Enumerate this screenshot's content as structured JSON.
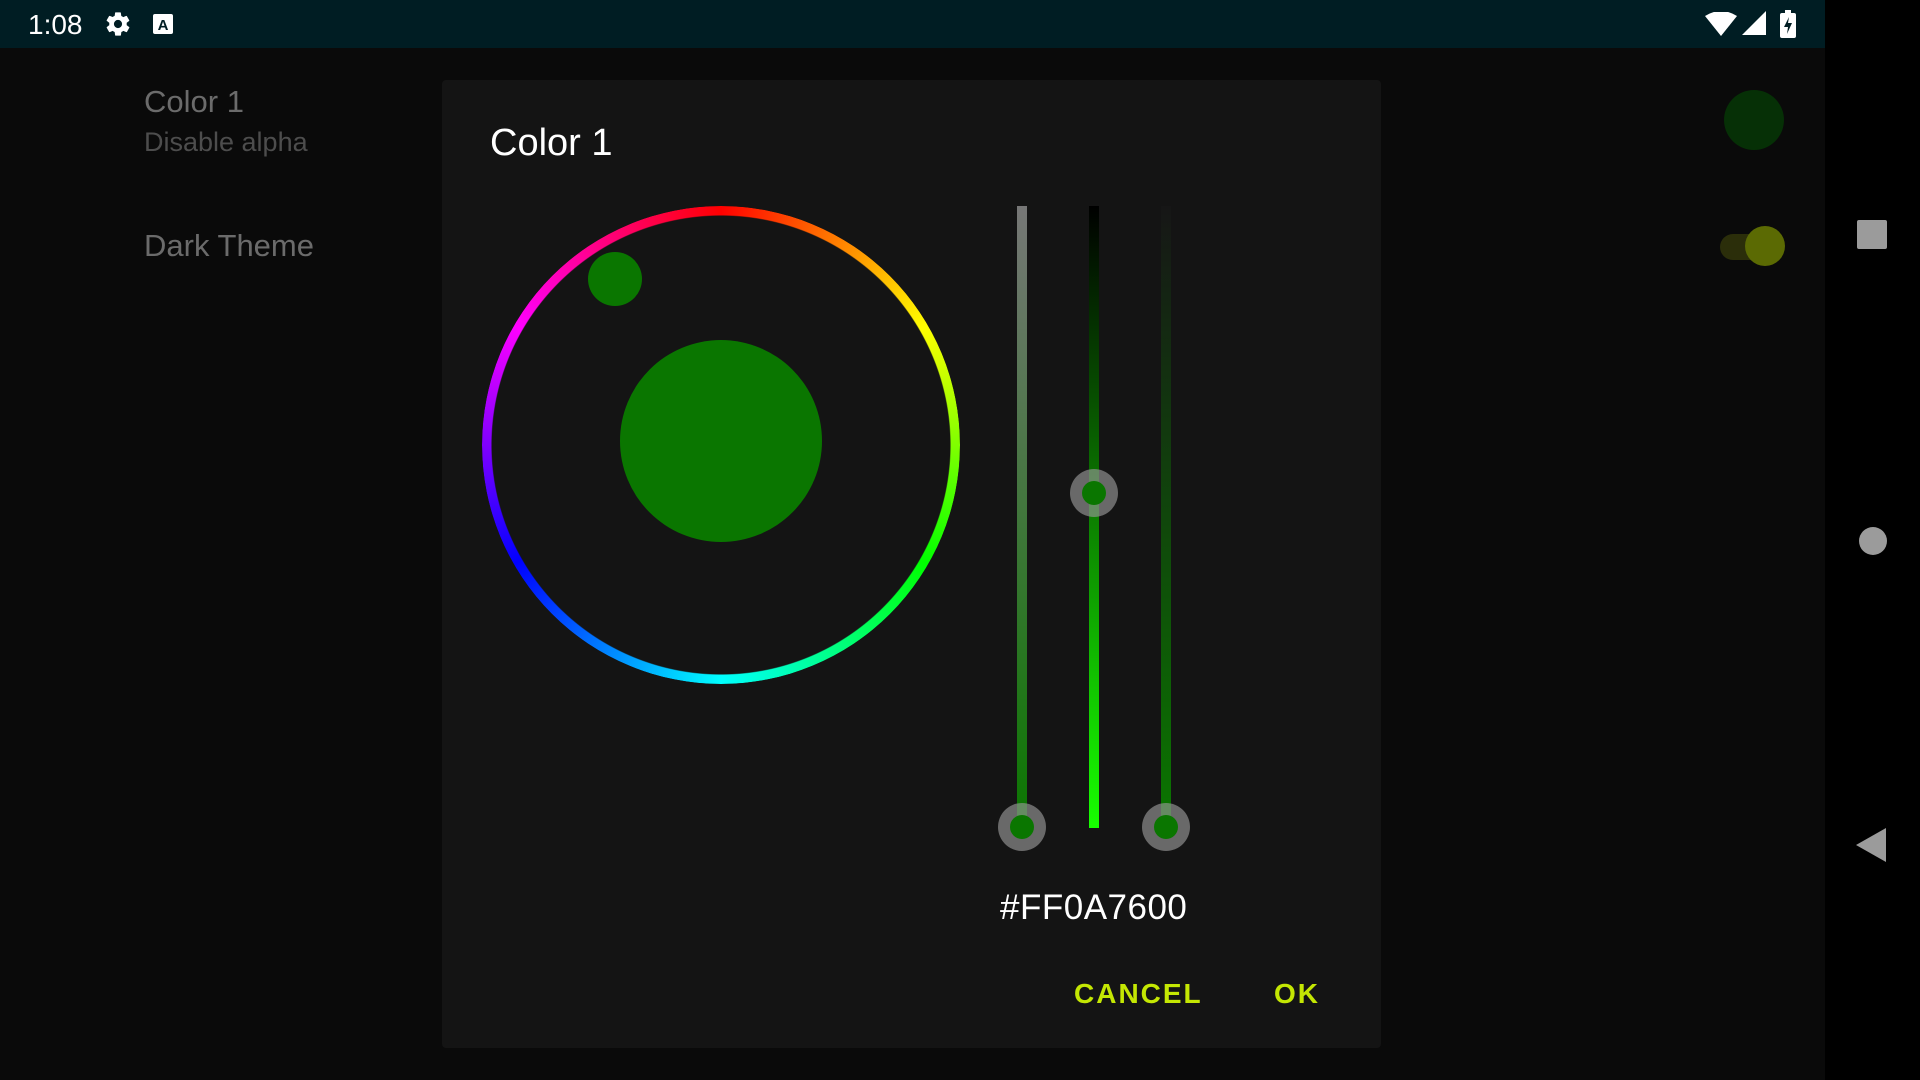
{
  "status_bar": {
    "time": "1:08",
    "icons": [
      "settings-gear-icon",
      "text-a-icon",
      "wifi-icon",
      "cell-signal-icon",
      "battery-charging-icon"
    ]
  },
  "preferences": {
    "color_pref": {
      "title": "Color 1",
      "summary": "Disable alpha",
      "swatch_color": "#063006"
    },
    "dark_theme": {
      "title": "Dark Theme",
      "enabled": true
    }
  },
  "dialog": {
    "title": "Color 1",
    "selected_color": "#0A7600",
    "hex_value": "#FF0A7600",
    "cancel_label": "CANCEL",
    "ok_label": "OK",
    "accent_color": "#C4E703",
    "sliders": [
      {
        "name": "alpha",
        "level": 1.0
      },
      {
        "name": "value",
        "level": 0.46
      },
      {
        "name": "saturation",
        "level": 1.0
      }
    ]
  },
  "nav_bar": {
    "icons": [
      "recents-square-icon",
      "home-circle-icon",
      "back-triangle-icon"
    ]
  }
}
